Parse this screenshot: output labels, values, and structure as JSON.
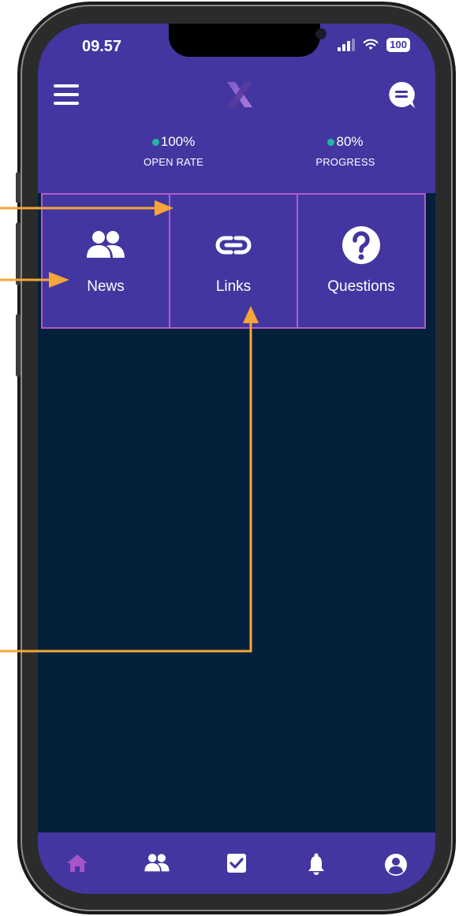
{
  "status_bar": {
    "time": "09.57",
    "battery": "100"
  },
  "header": {
    "logo_letter": "X"
  },
  "stats": [
    {
      "value": "100%",
      "label": "OPEN RATE"
    },
    {
      "value": "80%",
      "label": "PROGRESS"
    }
  ],
  "tiles": [
    {
      "label": "News",
      "icon": "users-icon"
    },
    {
      "label": "Links",
      "icon": "link-icon"
    },
    {
      "label": "Questions",
      "icon": "question-icon"
    }
  ],
  "bottom_nav": [
    {
      "icon": "home-icon",
      "active": true
    },
    {
      "icon": "users-icon"
    },
    {
      "icon": "checkbox-icon"
    },
    {
      "icon": "bell-icon"
    },
    {
      "icon": "profile-icon"
    }
  ],
  "colors": {
    "header_bg": "#4336a0",
    "content_bg": "#03203a",
    "tile_border": "#b25bc8",
    "dot": "#23b5a6",
    "arrow": "#f6a637",
    "active_nav": "#a855c8"
  }
}
